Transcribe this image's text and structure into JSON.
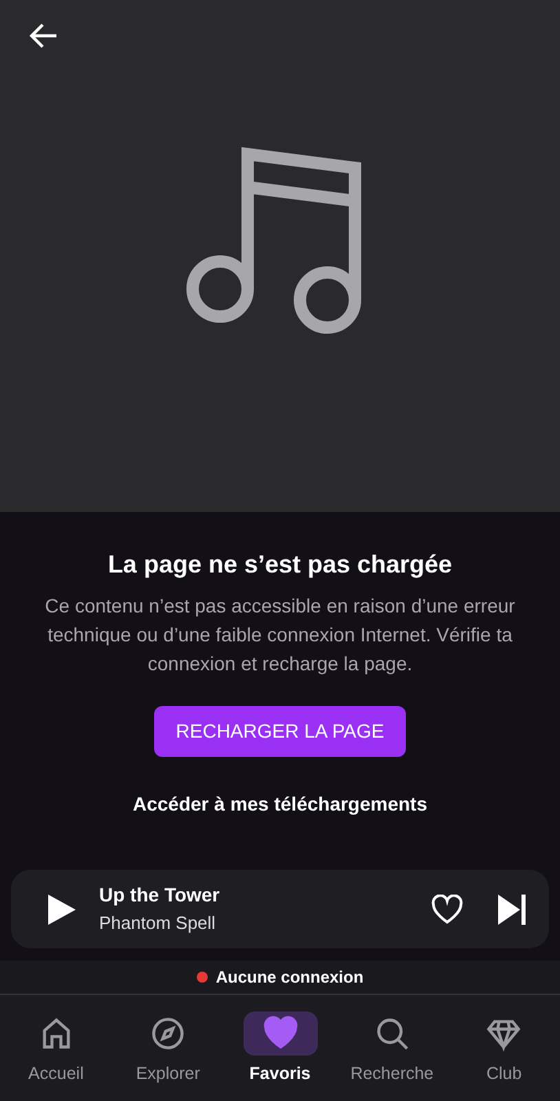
{
  "error": {
    "title": "La page ne s’est pas chargée",
    "message": "Ce contenu n’est pas accessible en raison d’une erreur technique ou d’une faible connexion Internet. Vérifie ta connexion et recharge la page.",
    "reload_button": "RECHARGER LA PAGE",
    "downloads_link": "Accéder à mes téléchargements"
  },
  "player": {
    "title": "Up the Tower",
    "artist": "Phantom Spell",
    "liked": false
  },
  "connection": {
    "label": "Aucune connexion",
    "color": "#e53935"
  },
  "nav": [
    {
      "kind": "home",
      "label": "Accueil",
      "selected": false
    },
    {
      "kind": "explore",
      "label": "Explorer",
      "selected": false
    },
    {
      "kind": "favorites",
      "label": "Favoris",
      "selected": true
    },
    {
      "kind": "search",
      "label": "Recherche",
      "selected": false
    },
    {
      "kind": "club",
      "label": "Club",
      "selected": false
    }
  ]
}
